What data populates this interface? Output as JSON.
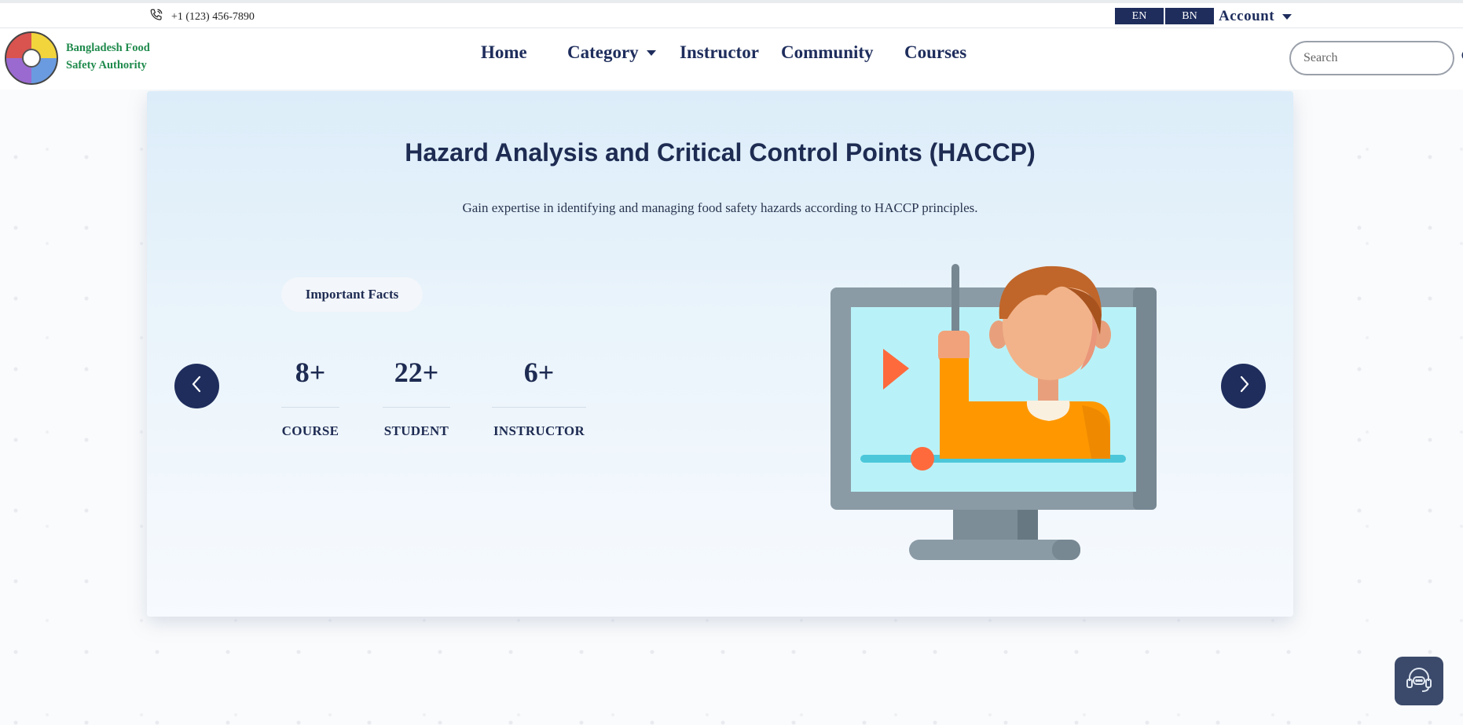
{
  "topbar": {
    "phone": "+1 (123) 456-7890",
    "lang_en": "EN",
    "lang_bn": "BN",
    "account_label": "Account"
  },
  "header": {
    "brand_line1": "Bangladesh Food",
    "brand_line2": "Safety Authority",
    "nav": [
      "Home",
      "Category",
      "Instructor",
      "Community",
      "Courses"
    ],
    "search_placeholder": "Search"
  },
  "hero": {
    "title": "Hazard Analysis and Critical Control Points (HACCP)",
    "subtitle": "Gain expertise in identifying and managing food safety hazards according to HACCP principles.",
    "facts_label": "Important Facts",
    "stats": [
      {
        "value": "8+",
        "label": "COURSE"
      },
      {
        "value": "22+",
        "label": "STUDENT"
      },
      {
        "value": "6+",
        "label": "INSTRUCTOR"
      }
    ]
  },
  "icons": {
    "phone": "phone-icon",
    "search": "search-icon",
    "prev": "chevron-left-icon",
    "next": "chevron-right-icon",
    "chat": "headset-support-icon"
  },
  "colors": {
    "navy": "#1e2d5c",
    "brand_green": "#1f8a4c",
    "hero_bg": "#dcedf9",
    "illus_shirt": "#ff9800",
    "illus_screen": "#b8f2f8"
  }
}
